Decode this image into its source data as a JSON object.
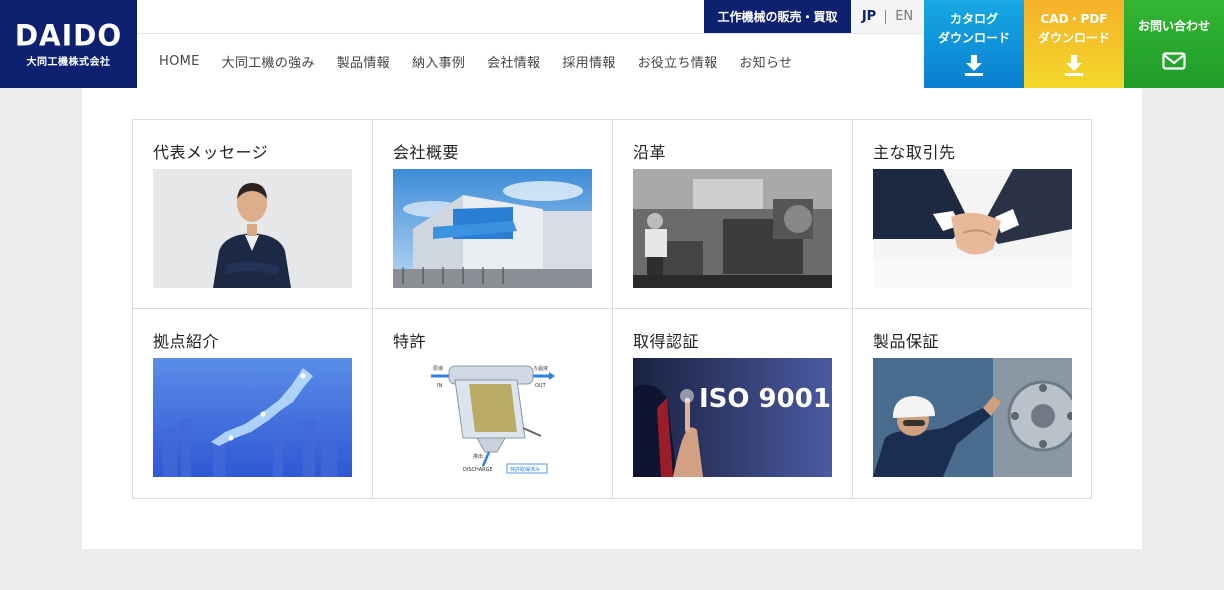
{
  "logo": {
    "main": "DAIDO",
    "sub": "大同工機株式会社"
  },
  "util": {
    "used_machine": "工作機械の販売・買取",
    "lang_jp": "JP",
    "lang_en": "EN"
  },
  "nav": {
    "items": [
      {
        "label": "HOME"
      },
      {
        "label": "大同工機の強み"
      },
      {
        "label": "製品情報"
      },
      {
        "label": "納入事例"
      },
      {
        "label": "会社情報"
      },
      {
        "label": "採用情報"
      },
      {
        "label": "お役立ち情報"
      },
      {
        "label": "お知らせ"
      }
    ]
  },
  "cta": {
    "catalog": {
      "line1": "カタログ",
      "line2": "ダウンロード",
      "icon": "download-icon"
    },
    "cad": {
      "line1": "CAD・PDF",
      "line2": "ダウンロード",
      "icon": "download-icon"
    },
    "contact": {
      "line1": "お問い合わせ",
      "icon": "mail-icon"
    }
  },
  "cards": [
    {
      "title": "代表メッセージ"
    },
    {
      "title": "会社概要"
    },
    {
      "title": "沿革"
    },
    {
      "title": "主な取引先"
    },
    {
      "title": "拠点紹介"
    },
    {
      "title": "特許"
    },
    {
      "title": "取得認証"
    },
    {
      "title": "製品保証"
    }
  ],
  "patent_diagram": {
    "label_in": "原液",
    "label_in2": "IN",
    "label_out": "ろ過液",
    "label_out2": "OUT",
    "label_drain": "排出",
    "label_discharge": "DISCHARGE",
    "badge": "特許取得済み"
  },
  "iso_text": "ISO 9001",
  "colors": {
    "brand_navy": "#0d2170",
    "catalog_blue": "#0a7fd0",
    "cad_yellow": "#f2c52a",
    "contact_green": "#2aaa2e"
  }
}
